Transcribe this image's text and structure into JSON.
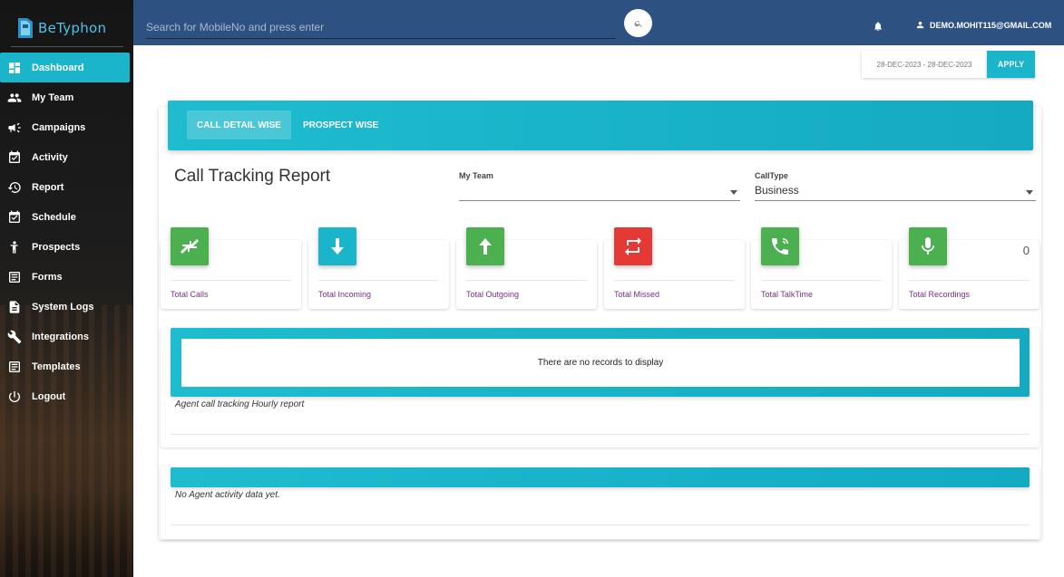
{
  "brand": {
    "name": "BeTyphon"
  },
  "sidebar": {
    "items": [
      {
        "label": "Dashboard",
        "icon": "dashboard-icon",
        "active": true
      },
      {
        "label": "My Team",
        "icon": "team-icon",
        "active": false
      },
      {
        "label": "Campaigns",
        "icon": "megaphone-icon",
        "active": false
      },
      {
        "label": "Activity",
        "icon": "calendar-check-icon",
        "active": false
      },
      {
        "label": "Report",
        "icon": "history-icon",
        "active": false
      },
      {
        "label": "Schedule",
        "icon": "calendar-check-icon",
        "active": false
      },
      {
        "label": "Prospects",
        "icon": "person-icon",
        "active": false
      },
      {
        "label": "Forms",
        "icon": "form-icon",
        "active": false
      },
      {
        "label": "System Logs",
        "icon": "document-icon",
        "active": false
      },
      {
        "label": "Integrations",
        "icon": "wrench-icon",
        "active": false
      },
      {
        "label": "Templates",
        "icon": "template-icon",
        "active": false
      },
      {
        "label": "Logout",
        "icon": "power-icon",
        "active": false
      }
    ]
  },
  "topbar": {
    "search_placeholder": "Search for MobileNo and press enter",
    "user_email": "DEMO.MOHIT115@GMAIL.COM"
  },
  "date_filter": {
    "range": "28-DEC-2023 - 28-DEC-2023",
    "apply_label": "APPLY"
  },
  "tabs": [
    {
      "label": "CALL DETAIL WISE",
      "active": true
    },
    {
      "label": "PROSPECT WISE",
      "active": false
    }
  ],
  "report": {
    "title": "Call Tracking Report",
    "filters": {
      "team_label": "My Team",
      "team_value": "",
      "calltype_label": "CallType",
      "calltype_value": "Business"
    }
  },
  "stats": [
    {
      "label": "Total Calls",
      "value": "",
      "color": "#4caf50",
      "icon": "arrows-in-icon"
    },
    {
      "label": "Total Incoming",
      "value": "",
      "color": "#1ab5ca",
      "icon": "arrow-down-icon"
    },
    {
      "label": "Total Outgoing",
      "value": "",
      "color": "#4caf50",
      "icon": "arrow-up-icon"
    },
    {
      "label": "Total Missed",
      "value": "",
      "color": "#e53935",
      "icon": "repeat-icon"
    },
    {
      "label": "Total TalkTime",
      "value": "",
      "color": "#4caf50",
      "icon": "phone-ringing-icon"
    },
    {
      "label": "Total Recordings",
      "value": "0",
      "color": "#4caf50",
      "icon": "microphone-icon"
    }
  ],
  "hourly": {
    "empty_message": "There are no records to display",
    "caption": "Agent call tracking Hourly report"
  },
  "agent_activity": {
    "caption": "No Agent activity data yet."
  },
  "colors": {
    "accent": "#1ab5ca",
    "topbar": "#2d5282",
    "stat_label": "#7b2d8b"
  }
}
